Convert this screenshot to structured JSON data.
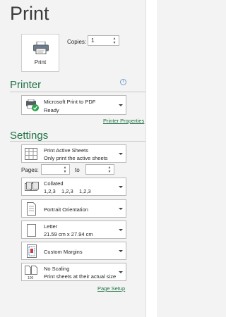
{
  "title": "Print",
  "print_button": {
    "label": "Print",
    "icon": "printer-icon"
  },
  "copies": {
    "label": "Copies:",
    "value": "1"
  },
  "printer": {
    "heading": "Printer",
    "selected": {
      "name": "Microsoft Print to PDF",
      "status": "Ready"
    },
    "properties_link": "Printer Properties"
  },
  "settings": {
    "heading": "Settings",
    "print_what": {
      "line1": "Print Active Sheets",
      "line2": "Only print the active sheets"
    },
    "pages": {
      "label": "Pages:",
      "to_label": "to",
      "from": "",
      "to": ""
    },
    "collation": {
      "line1": "Collated",
      "line2": "1,2,3    1,2,3    1,2,3"
    },
    "orientation": {
      "line1": "Portrait Orientation"
    },
    "paper": {
      "line1": "Letter",
      "line2": "21.59 cm x 27.94 cm"
    },
    "margins": {
      "line1": "Custom Margins"
    },
    "scaling": {
      "line1": "No Scaling",
      "line2": "Print sheets at their actual size"
    },
    "page_setup_link": "Page Setup"
  },
  "colors": {
    "accent": "#217346",
    "background": "#f3f3f3"
  }
}
